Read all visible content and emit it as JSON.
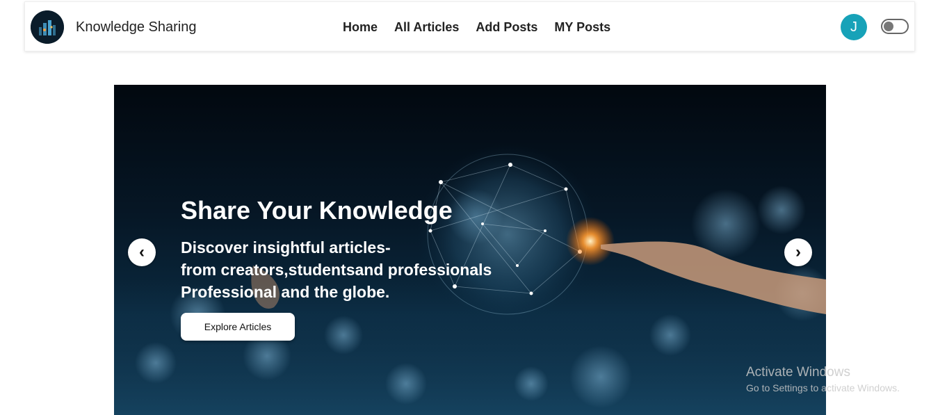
{
  "navbar": {
    "brand": "Knowledge Sharing",
    "links": [
      "Home",
      "All Articles",
      "Add Posts",
      "MY Posts"
    ],
    "avatar_initial": "J",
    "theme_toggle_on": false
  },
  "hero": {
    "title": "Share Your Knowledge",
    "subtitle_lines": [
      "Discover insightful articles-",
      "from creators,studentsand professionals",
      "Professional and the globe."
    ],
    "cta_label": "Explore Articles",
    "prev_arrow": "‹",
    "next_arrow": "›"
  },
  "watermark": {
    "title": "Activate Windows",
    "subtitle": "Go to Settings to activate Windows."
  },
  "colors": {
    "avatar_bg": "#17a2b8",
    "hero_bg": "#061726"
  },
  "icons": {
    "logo": "tech-city-logo",
    "prev": "chevron-left-icon",
    "next": "chevron-right-icon"
  }
}
